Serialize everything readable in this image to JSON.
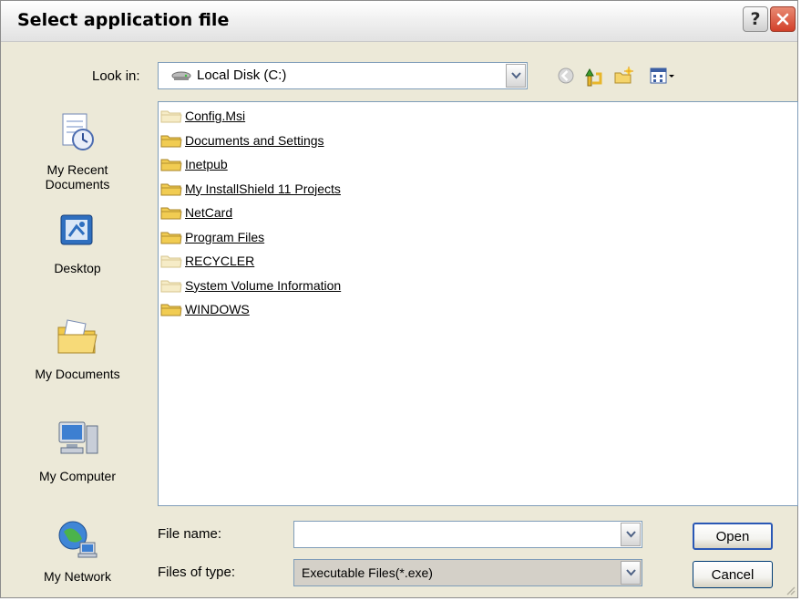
{
  "window": {
    "title": "Select application file",
    "help_icon": "question-mark-icon",
    "close_icon": "close-icon",
    "colors": {
      "close": "#d2402a",
      "frame": "#ece9d8",
      "input_border": "#7f9db9",
      "default_button_border": "#2a58b5"
    }
  },
  "lookin": {
    "label": "Look in:",
    "value": "Local Disk (C:)",
    "icon": "hard-drive-icon",
    "toolbar_icons": [
      "back-icon",
      "up-folder-icon",
      "new-folder-icon",
      "view-menu-icon"
    ]
  },
  "places": [
    {
      "label": "My Recent\nDocuments",
      "icon": "recent-documents-icon"
    },
    {
      "label": "Desktop",
      "icon": "desktop-icon"
    },
    {
      "label": "My Documents",
      "icon": "my-documents-icon"
    },
    {
      "label": "My Computer",
      "icon": "my-computer-icon"
    },
    {
      "label": "My Network",
      "icon": "my-network-icon"
    }
  ],
  "files": [
    {
      "name": "Config.Msi",
      "icon": "folder-icon",
      "hidden": true
    },
    {
      "name": "Documents and Settings",
      "icon": "folder-icon",
      "hidden": false
    },
    {
      "name": "Inetpub",
      "icon": "folder-icon",
      "hidden": false
    },
    {
      "name": "My InstallShield 11 Projects",
      "icon": "folder-icon",
      "hidden": false
    },
    {
      "name": "NetCard",
      "icon": "folder-icon",
      "hidden": false
    },
    {
      "name": "Program Files",
      "icon": "folder-icon",
      "hidden": false
    },
    {
      "name": "RECYCLER",
      "icon": "folder-icon",
      "hidden": true
    },
    {
      "name": "System Volume Information",
      "icon": "folder-icon",
      "hidden": true
    },
    {
      "name": "WINDOWS",
      "icon": "folder-icon",
      "hidden": false
    }
  ],
  "filename": {
    "label": "File name:",
    "value": ""
  },
  "filetype": {
    "label": "Files of type:",
    "value": "Executable Files(*.exe)"
  },
  "buttons": {
    "open": "Open",
    "cancel": "Cancel"
  }
}
